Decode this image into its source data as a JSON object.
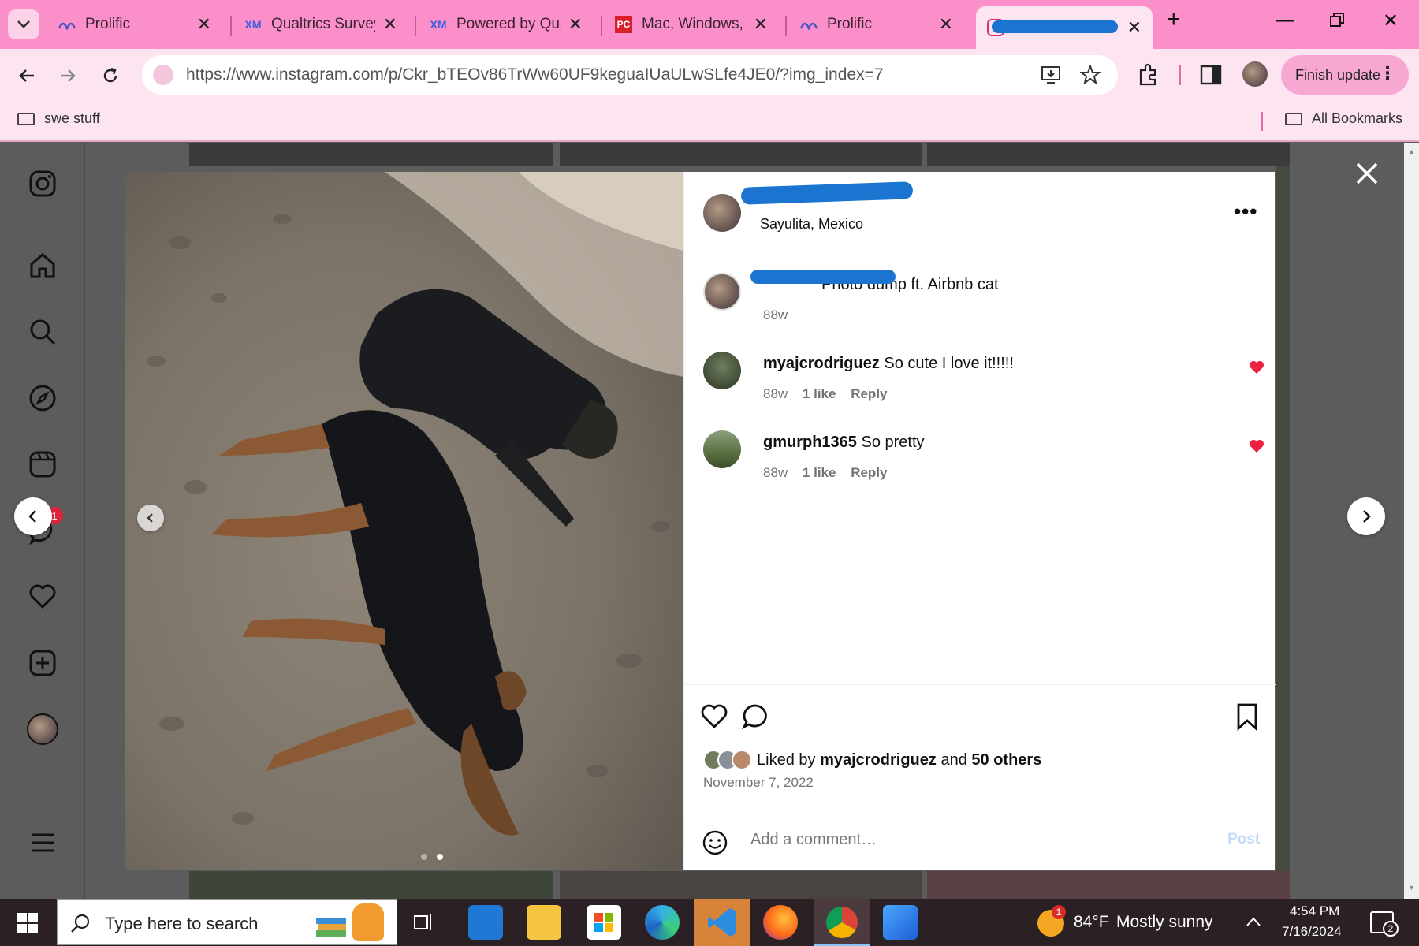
{
  "browser": {
    "tabs": [
      {
        "title": "Prolific",
        "favicon": "prolific-icon",
        "active": false
      },
      {
        "title": "Qualtrics Survey",
        "favicon": "qualtrics-icon",
        "active": false
      },
      {
        "title": "Powered by Qua",
        "favicon": "qualtrics-icon",
        "active": false
      },
      {
        "title": "Mac, Windows, (",
        "favicon": "pcmag-icon",
        "active": false
      },
      {
        "title": "Prolific",
        "favicon": "prolific-icon",
        "active": false
      },
      {
        "title": "",
        "favicon": "instagram-icon",
        "active": true
      }
    ],
    "url": "https://www.instagram.com/p/Ckr_bTEOv86TrWw60UF9keguaIUaULwSLfe4JE0/?img_index=7",
    "finish_update_label": "Finish update",
    "bookmarks": [
      {
        "label": "swe stuff"
      }
    ],
    "all_bookmarks_label": "All Bookmarks",
    "accent_color": "#fb8fc9"
  },
  "post": {
    "location": "Sayulita, Mexico",
    "caption": "Photo dump ft. Airbnb cat",
    "caption_age": "88w",
    "comments": [
      {
        "user": "myajcrodriguez",
        "text": "So cute I love it!!!!!",
        "age": "88w",
        "likes": "1 like",
        "reply": "Reply",
        "liked": true
      },
      {
        "user": "gmurph1365",
        "text": "So pretty",
        "age": "88w",
        "likes": "1 like",
        "reply": "Reply",
        "liked": true
      }
    ],
    "liked_by_prefix": "Liked by",
    "liked_by_user": "myajcrodriguez",
    "liked_by_and": "and",
    "liked_by_others": "50 others",
    "date": "November 7, 2022",
    "add_comment_placeholder": "Add a comment…",
    "post_label": "Post"
  },
  "sidebar": {
    "messages_badge": "1"
  },
  "taskbar": {
    "search_placeholder": "Type here to search",
    "weather_temp": "84°F",
    "weather_text": "Mostly sunny",
    "weather_badge": "1",
    "time": "4:54 PM",
    "date": "7/16/2024",
    "notifications": "2"
  }
}
